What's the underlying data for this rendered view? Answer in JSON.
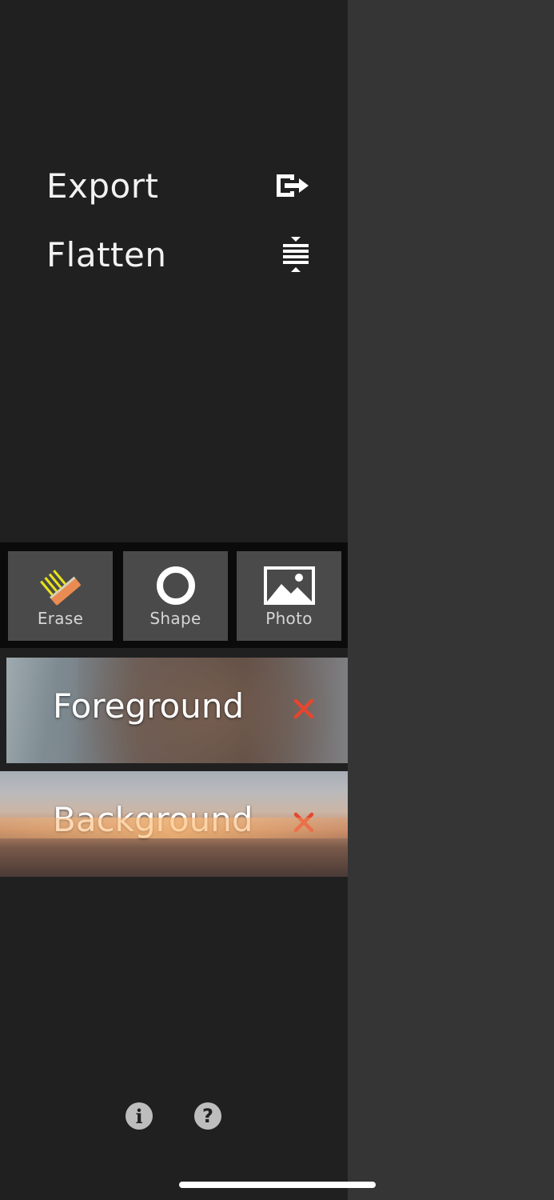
{
  "menu": {
    "export_label": "Export",
    "export_icon": "export-icon",
    "flatten_label": "Flatten",
    "flatten_icon": "flatten-icon"
  },
  "tools": [
    {
      "label": "Erase",
      "icon": "eraser-icon"
    },
    {
      "label": "Shape",
      "icon": "circle-shape-icon"
    },
    {
      "label": "Photo",
      "icon": "photo-icon"
    }
  ],
  "layers": [
    {
      "name": "Foreground",
      "delete_icon": "close-icon"
    },
    {
      "name": "Background",
      "delete_icon": "close-icon"
    }
  ],
  "footer": {
    "info_icon": "info-icon",
    "help_icon": "help-icon"
  },
  "colors": {
    "sidebar_bg": "#202020",
    "canvas_bg": "#353535",
    "tool_bg": "#4a4a4a",
    "delete_red": "#e5462f",
    "eraser_orange": "#e98b52",
    "eraser_yellow": "#e8e31c"
  }
}
